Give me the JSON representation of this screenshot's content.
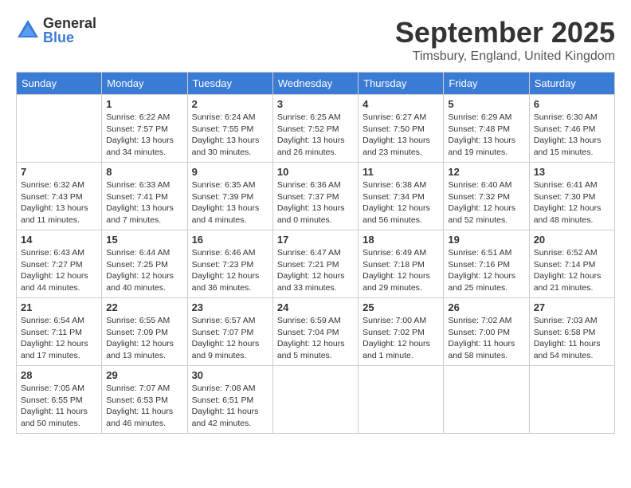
{
  "logo": {
    "general": "General",
    "blue": "Blue"
  },
  "title": "September 2025",
  "location": "Timsbury, England, United Kingdom",
  "weekdays": [
    "Sunday",
    "Monday",
    "Tuesday",
    "Wednesday",
    "Thursday",
    "Friday",
    "Saturday"
  ],
  "weeks": [
    [
      {
        "day": "",
        "info": ""
      },
      {
        "day": "1",
        "info": "Sunrise: 6:22 AM\nSunset: 7:57 PM\nDaylight: 13 hours\nand 34 minutes."
      },
      {
        "day": "2",
        "info": "Sunrise: 6:24 AM\nSunset: 7:55 PM\nDaylight: 13 hours\nand 30 minutes."
      },
      {
        "day": "3",
        "info": "Sunrise: 6:25 AM\nSunset: 7:52 PM\nDaylight: 13 hours\nand 26 minutes."
      },
      {
        "day": "4",
        "info": "Sunrise: 6:27 AM\nSunset: 7:50 PM\nDaylight: 13 hours\nand 23 minutes."
      },
      {
        "day": "5",
        "info": "Sunrise: 6:29 AM\nSunset: 7:48 PM\nDaylight: 13 hours\nand 19 minutes."
      },
      {
        "day": "6",
        "info": "Sunrise: 6:30 AM\nSunset: 7:46 PM\nDaylight: 13 hours\nand 15 minutes."
      }
    ],
    [
      {
        "day": "7",
        "info": "Sunrise: 6:32 AM\nSunset: 7:43 PM\nDaylight: 13 hours\nand 11 minutes."
      },
      {
        "day": "8",
        "info": "Sunrise: 6:33 AM\nSunset: 7:41 PM\nDaylight: 13 hours\nand 7 minutes."
      },
      {
        "day": "9",
        "info": "Sunrise: 6:35 AM\nSunset: 7:39 PM\nDaylight: 13 hours\nand 4 minutes."
      },
      {
        "day": "10",
        "info": "Sunrise: 6:36 AM\nSunset: 7:37 PM\nDaylight: 13 hours\nand 0 minutes."
      },
      {
        "day": "11",
        "info": "Sunrise: 6:38 AM\nSunset: 7:34 PM\nDaylight: 12 hours\nand 56 minutes."
      },
      {
        "day": "12",
        "info": "Sunrise: 6:40 AM\nSunset: 7:32 PM\nDaylight: 12 hours\nand 52 minutes."
      },
      {
        "day": "13",
        "info": "Sunrise: 6:41 AM\nSunset: 7:30 PM\nDaylight: 12 hours\nand 48 minutes."
      }
    ],
    [
      {
        "day": "14",
        "info": "Sunrise: 6:43 AM\nSunset: 7:27 PM\nDaylight: 12 hours\nand 44 minutes."
      },
      {
        "day": "15",
        "info": "Sunrise: 6:44 AM\nSunset: 7:25 PM\nDaylight: 12 hours\nand 40 minutes."
      },
      {
        "day": "16",
        "info": "Sunrise: 6:46 AM\nSunset: 7:23 PM\nDaylight: 12 hours\nand 36 minutes."
      },
      {
        "day": "17",
        "info": "Sunrise: 6:47 AM\nSunset: 7:21 PM\nDaylight: 12 hours\nand 33 minutes."
      },
      {
        "day": "18",
        "info": "Sunrise: 6:49 AM\nSunset: 7:18 PM\nDaylight: 12 hours\nand 29 minutes."
      },
      {
        "day": "19",
        "info": "Sunrise: 6:51 AM\nSunset: 7:16 PM\nDaylight: 12 hours\nand 25 minutes."
      },
      {
        "day": "20",
        "info": "Sunrise: 6:52 AM\nSunset: 7:14 PM\nDaylight: 12 hours\nand 21 minutes."
      }
    ],
    [
      {
        "day": "21",
        "info": "Sunrise: 6:54 AM\nSunset: 7:11 PM\nDaylight: 12 hours\nand 17 minutes."
      },
      {
        "day": "22",
        "info": "Sunrise: 6:55 AM\nSunset: 7:09 PM\nDaylight: 12 hours\nand 13 minutes."
      },
      {
        "day": "23",
        "info": "Sunrise: 6:57 AM\nSunset: 7:07 PM\nDaylight: 12 hours\nand 9 minutes."
      },
      {
        "day": "24",
        "info": "Sunrise: 6:59 AM\nSunset: 7:04 PM\nDaylight: 12 hours\nand 5 minutes."
      },
      {
        "day": "25",
        "info": "Sunrise: 7:00 AM\nSunset: 7:02 PM\nDaylight: 12 hours\nand 1 minute."
      },
      {
        "day": "26",
        "info": "Sunrise: 7:02 AM\nSunset: 7:00 PM\nDaylight: 11 hours\nand 58 minutes."
      },
      {
        "day": "27",
        "info": "Sunrise: 7:03 AM\nSunset: 6:58 PM\nDaylight: 11 hours\nand 54 minutes."
      }
    ],
    [
      {
        "day": "28",
        "info": "Sunrise: 7:05 AM\nSunset: 6:55 PM\nDaylight: 11 hours\nand 50 minutes."
      },
      {
        "day": "29",
        "info": "Sunrise: 7:07 AM\nSunset: 6:53 PM\nDaylight: 11 hours\nand 46 minutes."
      },
      {
        "day": "30",
        "info": "Sunrise: 7:08 AM\nSunset: 6:51 PM\nDaylight: 11 hours\nand 42 minutes."
      },
      {
        "day": "",
        "info": ""
      },
      {
        "day": "",
        "info": ""
      },
      {
        "day": "",
        "info": ""
      },
      {
        "day": "",
        "info": ""
      }
    ]
  ]
}
